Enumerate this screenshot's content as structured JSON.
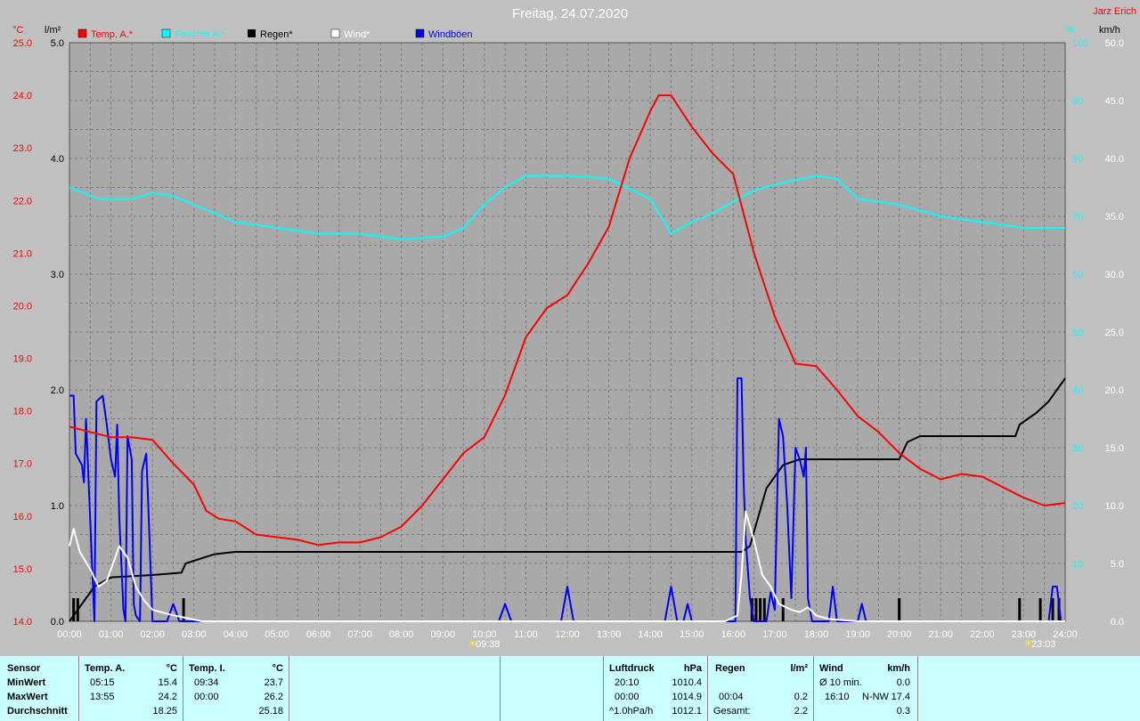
{
  "header": {
    "title": "Freitag, 24.07.2020",
    "author": "Jarz Erich"
  },
  "axis_units": {
    "left1": "°C",
    "left2": "l/m²",
    "right1": "%",
    "right2": "km/h"
  },
  "legend": [
    {
      "label": "Temp. A.*",
      "color": "#ff0000"
    },
    {
      "label": "Feuchte A.*",
      "color": "#00ffff"
    },
    {
      "label": "Regen*",
      "color": "#000000"
    },
    {
      "label": "Wind*",
      "color": "#ffffff"
    },
    {
      "label": "Windböen",
      "color": "#0000ff"
    }
  ],
  "sun_markers": {
    "rise": "09:38",
    "set": "23:03"
  },
  "chart_data": {
    "type": "line",
    "title": "Freitag, 24.07.2020",
    "x_ticks": [
      "00:00",
      "01:00",
      "02:00",
      "03:00",
      "04:00",
      "05:00",
      "06:00",
      "07:00",
      "08:00",
      "09:00",
      "10:00",
      "11:00",
      "12:00",
      "13:00",
      "14:00",
      "15:00",
      "16:00",
      "17:00",
      "18:00",
      "19:00",
      "20:00",
      "21:00",
      "22:00",
      "23:00",
      "24:00"
    ],
    "xlim": [
      0,
      24
    ],
    "axes": {
      "temp": {
        "unit": "°C",
        "range": [
          14.0,
          25.0
        ],
        "ticks": [
          "14.0",
          "15.0",
          "16.0",
          "17.0",
          "18.0",
          "19.0",
          "20.0",
          "21.0",
          "22.0",
          "23.0",
          "24.0",
          "25.0"
        ]
      },
      "rain": {
        "unit": "l/m²",
        "range": [
          0,
          5.0
        ],
        "ticks": [
          "0.0",
          "1.0",
          "2.0",
          "3.0",
          "4.0",
          "5.0"
        ]
      },
      "humidity": {
        "unit": "%",
        "range": [
          0,
          100
        ],
        "ticks": [
          "0",
          "10",
          "20",
          "30",
          "40",
          "50",
          "60",
          "70",
          "80",
          "90",
          "100"
        ]
      },
      "wind": {
        "unit": "km/h",
        "range": [
          0,
          50
        ],
        "ticks": [
          "0.0",
          "5.0",
          "10.0",
          "15.0",
          "20.0",
          "25.0",
          "30.0",
          "35.0",
          "40.0",
          "45.0",
          "50.0"
        ]
      }
    },
    "grid": true,
    "series": [
      {
        "name": "Temp. A.*",
        "axis": "temp",
        "color": "#ff0000",
        "points": [
          [
            0,
            17.7
          ],
          [
            0.5,
            17.6
          ],
          [
            1,
            17.5
          ],
          [
            1.5,
            17.5
          ],
          [
            2,
            17.45
          ],
          [
            2.5,
            17.0
          ],
          [
            3,
            16.6
          ],
          [
            3.3,
            16.1
          ],
          [
            3.6,
            15.95
          ],
          [
            4,
            15.9
          ],
          [
            4.5,
            15.65
          ],
          [
            5,
            15.6
          ],
          [
            5.5,
            15.55
          ],
          [
            6,
            15.45
          ],
          [
            6.5,
            15.5
          ],
          [
            7,
            15.5
          ],
          [
            7.5,
            15.6
          ],
          [
            8,
            15.8
          ],
          [
            8.5,
            16.2
          ],
          [
            9,
            16.7
          ],
          [
            9.5,
            17.2
          ],
          [
            10,
            17.5
          ],
          [
            10.5,
            18.3
          ],
          [
            11,
            19.4
          ],
          [
            11.5,
            19.95
          ],
          [
            12,
            20.2
          ],
          [
            12.5,
            20.8
          ],
          [
            13,
            21.5
          ],
          [
            13.5,
            22.8
          ],
          [
            14,
            23.7
          ],
          [
            14.2,
            24.0
          ],
          [
            14.5,
            24.0
          ],
          [
            15,
            23.4
          ],
          [
            15.5,
            22.9
          ],
          [
            16,
            22.5
          ],
          [
            16.5,
            21.0
          ],
          [
            17,
            19.8
          ],
          [
            17.5,
            18.9
          ],
          [
            18,
            18.85
          ],
          [
            18.5,
            18.4
          ],
          [
            19,
            17.9
          ],
          [
            19.5,
            17.6
          ],
          [
            20,
            17.2
          ],
          [
            20.5,
            16.9
          ],
          [
            21,
            16.7
          ],
          [
            21.5,
            16.8
          ],
          [
            22,
            16.75
          ],
          [
            22.5,
            16.55
          ],
          [
            23,
            16.35
          ],
          [
            23.5,
            16.2
          ],
          [
            24,
            16.25
          ]
        ]
      },
      {
        "name": "Feuchte A.*",
        "axis": "humidity",
        "color": "#00ffff",
        "points": [
          [
            0,
            75
          ],
          [
            0.7,
            73
          ],
          [
            1.5,
            73
          ],
          [
            2,
            74
          ],
          [
            2.5,
            73.5
          ],
          [
            3,
            72
          ],
          [
            4,
            69
          ],
          [
            5,
            68
          ],
          [
            6,
            67
          ],
          [
            7,
            67
          ],
          [
            8,
            66
          ],
          [
            9,
            66.5
          ],
          [
            9.5,
            68
          ],
          [
            10,
            72
          ],
          [
            10.5,
            75
          ],
          [
            11,
            77
          ],
          [
            12,
            77
          ],
          [
            13,
            76.5
          ],
          [
            14,
            73
          ],
          [
            14.5,
            67
          ],
          [
            15,
            69
          ],
          [
            15.5,
            70.5
          ],
          [
            16,
            72.5
          ],
          [
            16.5,
            74.5
          ],
          [
            17,
            75.5
          ],
          [
            18,
            77
          ],
          [
            18.5,
            76.5
          ],
          [
            19,
            73
          ],
          [
            20,
            72
          ],
          [
            21,
            70
          ],
          [
            22,
            69
          ],
          [
            23,
            68
          ],
          [
            24,
            68
          ]
        ]
      },
      {
        "name": "Regen*",
        "axis": "rain",
        "color": "#000000",
        "points": [
          [
            0,
            0
          ],
          [
            0.3,
            0.15
          ],
          [
            0.6,
            0.3
          ],
          [
            1,
            0.38
          ],
          [
            2,
            0.4
          ],
          [
            2.7,
            0.42
          ],
          [
            2.8,
            0.5
          ],
          [
            3.5,
            0.58
          ],
          [
            4,
            0.6
          ],
          [
            5,
            0.6
          ],
          [
            8,
            0.6
          ],
          [
            12,
            0.6
          ],
          [
            16.2,
            0.6
          ],
          [
            16.4,
            0.65
          ],
          [
            16.6,
            0.9
          ],
          [
            16.8,
            1.15
          ],
          [
            17.2,
            1.35
          ],
          [
            17.6,
            1.4
          ],
          [
            18,
            1.4
          ],
          [
            19.5,
            1.4
          ],
          [
            20,
            1.4
          ],
          [
            20.2,
            1.55
          ],
          [
            20.5,
            1.6
          ],
          [
            21,
            1.6
          ],
          [
            22,
            1.6
          ],
          [
            22.8,
            1.6
          ],
          [
            22.9,
            1.7
          ],
          [
            23.3,
            1.8
          ],
          [
            23.6,
            1.9
          ],
          [
            23.8,
            2.0
          ],
          [
            24,
            2.1
          ]
        ]
      },
      {
        "name": "Wind*",
        "axis": "wind",
        "color": "#ffffff",
        "points": [
          [
            0,
            6.5
          ],
          [
            0.1,
            8
          ],
          [
            0.25,
            6
          ],
          [
            0.5,
            4.5
          ],
          [
            0.7,
            3
          ],
          [
            0.9,
            3.5
          ],
          [
            1,
            4.5
          ],
          [
            1.2,
            6.5
          ],
          [
            1.4,
            5.5
          ],
          [
            1.6,
            3
          ],
          [
            1.8,
            1.8
          ],
          [
            2,
            1
          ],
          [
            2.4,
            0.6
          ],
          [
            2.8,
            0.3
          ],
          [
            3.2,
            0
          ],
          [
            15.8,
            0
          ],
          [
            16.1,
            0.5
          ],
          [
            16.2,
            4
          ],
          [
            16.3,
            9.5
          ],
          [
            16.5,
            7
          ],
          [
            16.7,
            4
          ],
          [
            16.9,
            3
          ],
          [
            17.1,
            1.5
          ],
          [
            17.4,
            1
          ],
          [
            17.6,
            0.8
          ],
          [
            17.8,
            1.2
          ],
          [
            18,
            0.5
          ],
          [
            18.3,
            0.2
          ],
          [
            19,
            0
          ],
          [
            24,
            0
          ]
        ]
      },
      {
        "name": "Windböen",
        "axis": "wind",
        "color": "#0000ff",
        "points": [
          [
            0,
            19.5
          ],
          [
            0.1,
            19.5
          ],
          [
            0.15,
            14.5
          ],
          [
            0.3,
            13.5
          ],
          [
            0.35,
            12
          ],
          [
            0.4,
            17.5
          ],
          [
            0.45,
            13
          ],
          [
            0.6,
            0
          ],
          [
            0.6,
            0
          ],
          [
            0.65,
            19
          ],
          [
            0.8,
            19.5
          ],
          [
            0.9,
            17
          ],
          [
            1.0,
            14
          ],
          [
            1.1,
            12.5
          ],
          [
            1.15,
            17
          ],
          [
            1.2,
            9
          ],
          [
            1.3,
            1
          ],
          [
            1.35,
            0
          ],
          [
            1.4,
            16
          ],
          [
            1.5,
            14
          ],
          [
            1.55,
            1.5
          ],
          [
            1.6,
            0.5
          ],
          [
            1.7,
            0
          ],
          [
            1.75,
            13
          ],
          [
            1.85,
            14.5
          ],
          [
            1.9,
            10
          ],
          [
            2.0,
            0
          ],
          [
            2.35,
            0
          ],
          [
            2.5,
            1.5
          ],
          [
            2.65,
            0
          ],
          [
            10.35,
            0
          ],
          [
            10.5,
            1.5
          ],
          [
            10.65,
            0
          ],
          [
            11.85,
            0
          ],
          [
            12.0,
            3
          ],
          [
            12.15,
            0
          ],
          [
            14.35,
            0
          ],
          [
            14.5,
            3
          ],
          [
            14.65,
            0
          ],
          [
            14.8,
            0
          ],
          [
            14.9,
            1.5
          ],
          [
            15.0,
            0
          ],
          [
            16.05,
            0
          ],
          [
            16.1,
            21
          ],
          [
            16.2,
            21
          ],
          [
            16.25,
            12
          ],
          [
            16.3,
            7
          ],
          [
            16.4,
            2
          ],
          [
            16.5,
            0
          ],
          [
            16.8,
            0
          ],
          [
            16.9,
            2.5
          ],
          [
            17.0,
            1
          ],
          [
            17.1,
            17.5
          ],
          [
            17.2,
            16
          ],
          [
            17.3,
            10
          ],
          [
            17.4,
            2
          ],
          [
            17.5,
            15
          ],
          [
            17.6,
            14
          ],
          [
            17.7,
            12.5
          ],
          [
            17.75,
            15
          ],
          [
            17.8,
            2
          ],
          [
            17.9,
            0
          ],
          [
            18.3,
            0
          ],
          [
            18.4,
            3
          ],
          [
            18.5,
            0
          ],
          [
            19.0,
            0
          ],
          [
            19.1,
            1.5
          ],
          [
            19.2,
            0
          ],
          [
            23.6,
            0
          ],
          [
            23.7,
            3
          ],
          [
            23.8,
            3
          ],
          [
            23.9,
            0
          ],
          [
            24,
            0
          ]
        ]
      }
    ],
    "rain_bars": [
      0.1,
      0.2,
      2.75,
      16.45,
      16.55,
      16.65,
      16.75,
      17.2,
      20.0,
      22.9,
      23.4,
      23.7,
      23.85
    ],
    "rain_bar_height": 0.2,
    "extra_peak_bars": [
      0.05,
      0.12
    ]
  },
  "stats": {
    "col_sensor": {
      "header": "Sensor",
      "rows": [
        "MinWert",
        "MaxWert",
        "Durchschnitt"
      ]
    },
    "temp_a": {
      "header": "Temp. A.",
      "unit": "°C",
      "min_time": "05:15",
      "min_val": "15.4",
      "max_time": "13:55",
      "max_val": "24.2",
      "avg_val": "18.25"
    },
    "temp_i": {
      "header": "Temp. I.",
      "unit": "°C",
      "min_time": "09:34",
      "min_val": "23.7",
      "max_time": "00:00",
      "max_val": "26.2",
      "avg_val": "25.18"
    },
    "luftdruck": {
      "header": "Luftdruck",
      "unit": "hPa",
      "min_time": "20:10",
      "min_val": "1010.4",
      "max_time": "00:00",
      "max_val": "1014.9",
      "avg_time": "^1.0hPa/h",
      "avg_val": "1012.1"
    },
    "regen": {
      "header": "Regen",
      "unit": "l/m²",
      "max_time": "00:04",
      "max_val": "0.2",
      "avg_time": "Gesamt:",
      "avg_val": "2.2"
    },
    "wind": {
      "header": "Wind",
      "unit": "km/h",
      "min_label": "Ø 10 min.",
      "min_val": "0.0",
      "max_time": "16:10",
      "max_dir": "N-NW",
      "max_val": "17.4",
      "avg_val": "0.3"
    }
  }
}
